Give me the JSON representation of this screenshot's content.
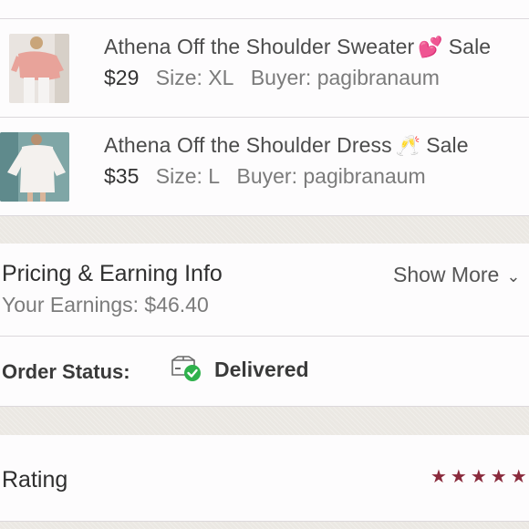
{
  "items": [
    {
      "title": "Athena Off the Shoulder Sweater",
      "emoji": "💕",
      "suffix": "Sale",
      "price": "$29",
      "size_label": "Size:",
      "size": "XL",
      "buyer_label": "Buyer:",
      "buyer": "pagibranaum",
      "thumb_icon": "pink-sweater-photo"
    },
    {
      "title": "Athena Off the Shoulder Dress",
      "emoji": "🥂",
      "suffix": "Sale",
      "price": "$35",
      "size_label": "Size:",
      "size": "L",
      "buyer_label": "Buyer:",
      "buyer": "pagibranaum",
      "thumb_icon": "white-dress-photo"
    }
  ],
  "pricing": {
    "title": "Pricing & Earning Info",
    "show_more": "Show More",
    "earnings": "Your Earnings: $46.40"
  },
  "order_status": {
    "label": "Order Status:",
    "value": "Delivered",
    "icon": "delivered-box-check-icon"
  },
  "rating": {
    "label": "Rating",
    "stars": "★★★★★",
    "star_color": "#8a2a3c"
  }
}
